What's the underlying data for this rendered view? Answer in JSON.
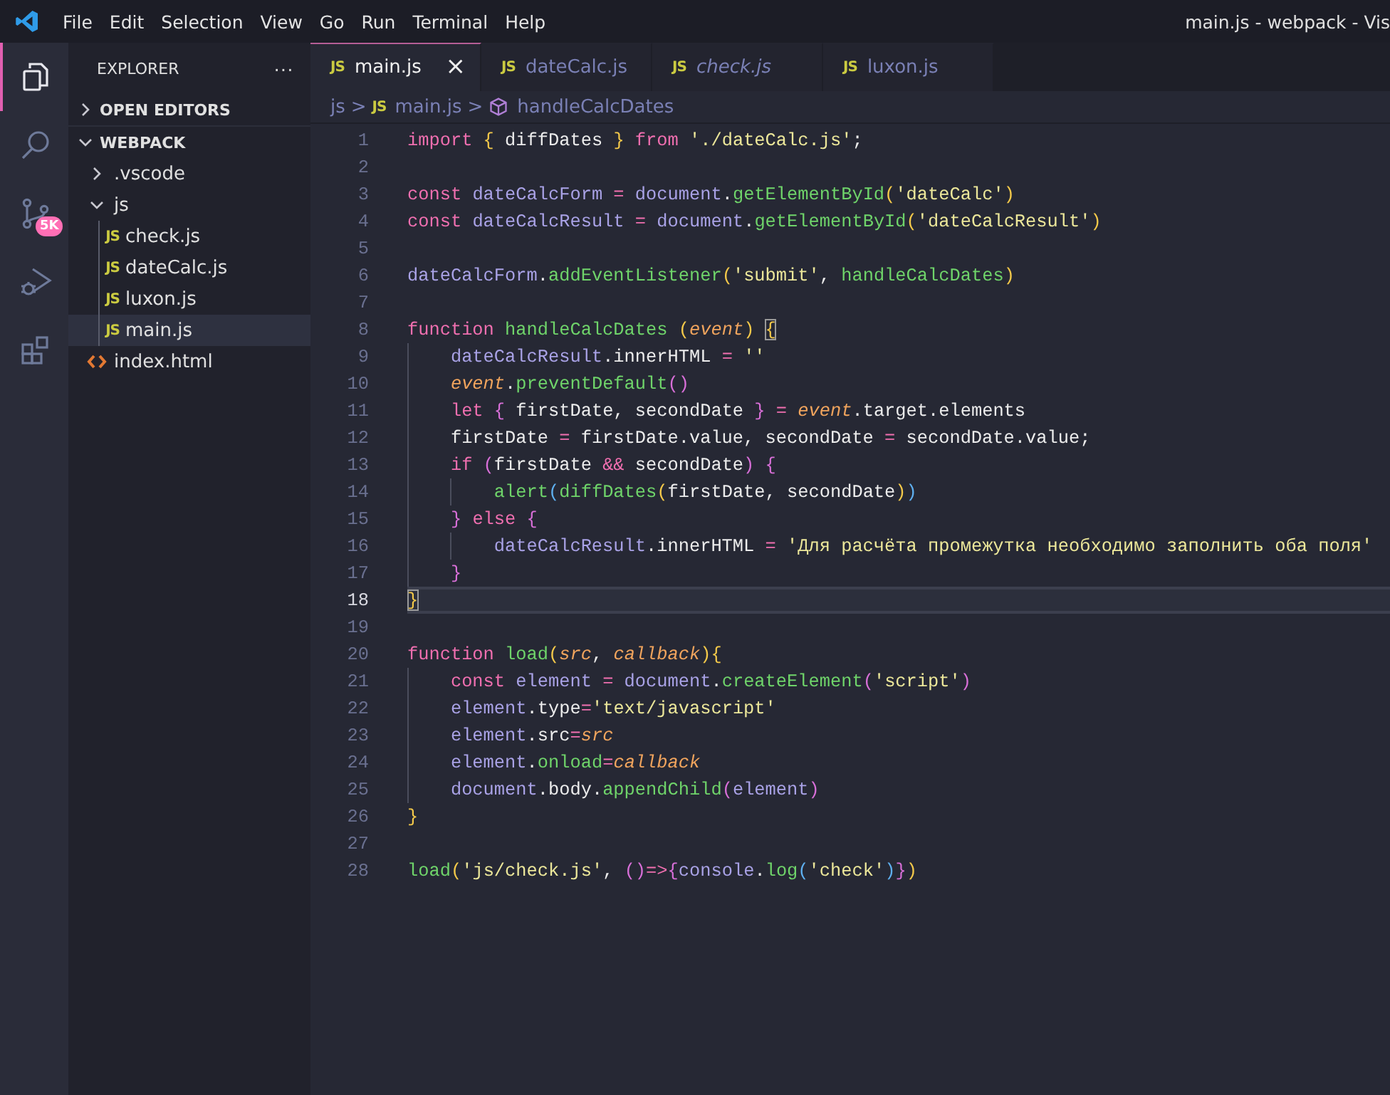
{
  "window": {
    "title": "main.js - webpack - Vis"
  },
  "menu": [
    "File",
    "Edit",
    "Selection",
    "View",
    "Go",
    "Run",
    "Terminal",
    "Help"
  ],
  "activity_bar": [
    {
      "kind": "explorer",
      "selected": true
    },
    {
      "kind": "search",
      "selected": false
    },
    {
      "kind": "source-control",
      "selected": false,
      "badge": "5K"
    },
    {
      "kind": "run-debug",
      "selected": false
    },
    {
      "kind": "extensions",
      "selected": false
    }
  ],
  "sidebar": {
    "title": "EXPLORER",
    "more": "···",
    "sections": [
      {
        "title": "OPEN EDITORS",
        "expanded": false
      },
      {
        "title": "WEBPACK",
        "expanded": true,
        "items": [
          {
            "name": ".vscode",
            "kind": "folder",
            "expanded": false,
            "selected": false
          },
          {
            "name": "js",
            "kind": "folder",
            "expanded": true,
            "selected": false,
            "children": [
              {
                "name": "check.js",
                "kind": "js",
                "icon": "JS",
                "selected": false
              },
              {
                "name": "dateCalc.js",
                "kind": "js",
                "icon": "JS",
                "selected": false
              },
              {
                "name": "luxon.js",
                "kind": "js",
                "icon": "JS",
                "selected": false
              },
              {
                "name": "main.js",
                "kind": "js",
                "icon": "JS",
                "selected": true
              }
            ]
          },
          {
            "name": "index.html",
            "kind": "html",
            "selected": false
          }
        ]
      }
    ]
  },
  "tabs": [
    {
      "label": "main.js",
      "icon": "JS",
      "selected": true,
      "preview": false,
      "close": "×"
    },
    {
      "label": "dateCalc.js",
      "icon": "JS",
      "selected": false,
      "preview": false
    },
    {
      "label": "check.js",
      "icon": "JS",
      "selected": false,
      "preview": true
    },
    {
      "label": "luxon.js",
      "icon": "JS",
      "selected": false,
      "preview": false
    }
  ],
  "breadcrumb": [
    {
      "kind": "folder",
      "label": "js"
    },
    {
      "kind": "js",
      "icon": "JS",
      "label": "main.js"
    },
    {
      "kind": "symbol",
      "label": "handleCalcDates"
    }
  ],
  "breadcrumb_separator": ">",
  "code": [
    {
      "number": "1",
      "current": false,
      "tokens": [
        {
          "text": "import ",
          "kind": "k"
        },
        {
          "text": "{",
          "kind": "b1"
        },
        {
          "text": " diffDates ",
          "kind": "w"
        },
        {
          "text": "}",
          "kind": "b1"
        },
        {
          "text": " from ",
          "kind": "k"
        },
        {
          "text": "'./dateCalc.js'",
          "kind": "s"
        },
        {
          "text": ";",
          "kind": "w"
        }
      ]
    },
    {
      "number": "2",
      "current": false
    },
    {
      "number": "3",
      "current": false,
      "tokens": [
        {
          "text": "const ",
          "kind": "k"
        },
        {
          "text": "dateCalcForm ",
          "kind": "v"
        },
        {
          "text": "= ",
          "kind": "o"
        },
        {
          "text": "document",
          "kind": "v"
        },
        {
          "text": ".",
          "kind": "w"
        },
        {
          "text": "getElementById",
          "kind": "f"
        },
        {
          "text": "(",
          "kind": "b1"
        },
        {
          "text": "'dateCalc'",
          "kind": "s"
        },
        {
          "text": ")",
          "kind": "b1"
        }
      ]
    },
    {
      "number": "4",
      "current": false,
      "tokens": [
        {
          "text": "const ",
          "kind": "k"
        },
        {
          "text": "dateCalcResult ",
          "kind": "v"
        },
        {
          "text": "= ",
          "kind": "o"
        },
        {
          "text": "document",
          "kind": "v"
        },
        {
          "text": ".",
          "kind": "w"
        },
        {
          "text": "getElementById",
          "kind": "f"
        },
        {
          "text": "(",
          "kind": "b1"
        },
        {
          "text": "'dateCalcResult'",
          "kind": "s"
        },
        {
          "text": ")",
          "kind": "b1"
        }
      ]
    },
    {
      "number": "5",
      "current": false
    },
    {
      "number": "6",
      "current": false,
      "tokens": [
        {
          "text": "dateCalcForm",
          "kind": "v"
        },
        {
          "text": ".",
          "kind": "w"
        },
        {
          "text": "addEventListener",
          "kind": "f"
        },
        {
          "text": "(",
          "kind": "b1"
        },
        {
          "text": "'submit'",
          "kind": "s"
        },
        {
          "text": ", ",
          "kind": "w"
        },
        {
          "text": "handleCalcDates",
          "kind": "f"
        },
        {
          "text": ")",
          "kind": "b1"
        }
      ]
    },
    {
      "number": "7",
      "current": false
    },
    {
      "number": "8",
      "current": false,
      "tokens": [
        {
          "text": "function ",
          "kind": "k"
        },
        {
          "text": "handleCalcDates ",
          "kind": "f"
        },
        {
          "text": "(",
          "kind": "b1"
        },
        {
          "text": "event",
          "kind": "p"
        },
        {
          "text": ") ",
          "kind": "b1"
        },
        {
          "text": "{",
          "kind": "bm"
        }
      ]
    },
    {
      "number": "9",
      "current": false,
      "tokens": [
        {
          "text": "    dateCalcResult",
          "kind": "v"
        },
        {
          "text": ".innerHTML ",
          "kind": "w"
        },
        {
          "text": "= ",
          "kind": "o"
        },
        {
          "text": "''",
          "kind": "s"
        }
      ]
    },
    {
      "number": "10",
      "current": false,
      "tokens": [
        {
          "text": "    event",
          "kind": "p"
        },
        {
          "text": ".",
          "kind": "w"
        },
        {
          "text": "preventDefault",
          "kind": "f"
        },
        {
          "text": "()",
          "kind": "b2"
        }
      ]
    },
    {
      "number": "11",
      "current": false,
      "tokens": [
        {
          "text": "    let ",
          "kind": "k"
        },
        {
          "text": "{",
          "kind": "b2"
        },
        {
          "text": " firstDate, secondDate ",
          "kind": "w"
        },
        {
          "text": "}",
          "kind": "b2"
        },
        {
          "text": " = ",
          "kind": "o"
        },
        {
          "text": "event",
          "kind": "p"
        },
        {
          "text": ".target.elements",
          "kind": "w"
        }
      ]
    },
    {
      "number": "12",
      "current": false,
      "tokens": [
        {
          "text": "    firstDate ",
          "kind": "w"
        },
        {
          "text": "= ",
          "kind": "o"
        },
        {
          "text": "firstDate.value, secondDate ",
          "kind": "w"
        },
        {
          "text": "= ",
          "kind": "o"
        },
        {
          "text": "secondDate.value;",
          "kind": "w"
        }
      ]
    },
    {
      "number": "13",
      "current": false,
      "tokens": [
        {
          "text": "    if ",
          "kind": "k"
        },
        {
          "text": "(",
          "kind": "b2"
        },
        {
          "text": "firstDate ",
          "kind": "w"
        },
        {
          "text": "&& ",
          "kind": "o"
        },
        {
          "text": "secondDate",
          "kind": "w"
        },
        {
          "text": ") {",
          "kind": "b2"
        }
      ]
    },
    {
      "number": "14",
      "current": false,
      "tokens": [
        {
          "text": "        alert",
          "kind": "f"
        },
        {
          "text": "(",
          "kind": "b3"
        },
        {
          "text": "diffDates",
          "kind": "f"
        },
        {
          "text": "(",
          "kind": "b1"
        },
        {
          "text": "firstDate, secondDate",
          "kind": "w"
        },
        {
          "text": ")",
          "kind": "b1"
        },
        {
          "text": ")",
          "kind": "b3"
        }
      ]
    },
    {
      "number": "15",
      "current": false,
      "tokens": [
        {
          "text": "    }",
          "kind": "b2"
        },
        {
          "text": " else ",
          "kind": "k"
        },
        {
          "text": "{",
          "kind": "b2"
        }
      ]
    },
    {
      "number": "16",
      "current": false,
      "tokens": [
        {
          "text": "        dateCalcResult",
          "kind": "v"
        },
        {
          "text": ".innerHTML ",
          "kind": "w"
        },
        {
          "text": "= ",
          "kind": "o"
        },
        {
          "text": "'Для расчёта промежутка необходимо заполнить оба поля'",
          "kind": "s"
        }
      ]
    },
    {
      "number": "17",
      "current": false,
      "tokens": [
        {
          "text": "    }",
          "kind": "b2"
        }
      ]
    },
    {
      "number": "18",
      "current": true,
      "tokens": [
        {
          "text": "}",
          "kind": "bm"
        }
      ]
    },
    {
      "number": "19",
      "current": false
    },
    {
      "number": "20",
      "current": false,
      "tokens": [
        {
          "text": "function ",
          "kind": "k"
        },
        {
          "text": "load",
          "kind": "f"
        },
        {
          "text": "(",
          "kind": "b1"
        },
        {
          "text": "src",
          "kind": "p"
        },
        {
          "text": ", ",
          "kind": "w"
        },
        {
          "text": "callback",
          "kind": "p"
        },
        {
          "text": "){",
          "kind": "b1"
        }
      ]
    },
    {
      "number": "21",
      "current": false,
      "tokens": [
        {
          "text": "    const ",
          "kind": "k"
        },
        {
          "text": "element ",
          "kind": "v"
        },
        {
          "text": "= ",
          "kind": "o"
        },
        {
          "text": "document",
          "kind": "v"
        },
        {
          "text": ".",
          "kind": "w"
        },
        {
          "text": "createElement",
          "kind": "f"
        },
        {
          "text": "(",
          "kind": "b2"
        },
        {
          "text": "'script'",
          "kind": "s"
        },
        {
          "text": ")",
          "kind": "b2"
        }
      ]
    },
    {
      "number": "22",
      "current": false,
      "tokens": [
        {
          "text": "    element",
          "kind": "v"
        },
        {
          "text": ".type",
          "kind": "w"
        },
        {
          "text": "=",
          "kind": "o"
        },
        {
          "text": "'text/javascript'",
          "kind": "s"
        }
      ]
    },
    {
      "number": "23",
      "current": false,
      "tokens": [
        {
          "text": "    element",
          "kind": "v"
        },
        {
          "text": ".src",
          "kind": "w"
        },
        {
          "text": "=",
          "kind": "o"
        },
        {
          "text": "src",
          "kind": "p"
        }
      ]
    },
    {
      "number": "24",
      "current": false,
      "tokens": [
        {
          "text": "    element",
          "kind": "v"
        },
        {
          "text": ".",
          "kind": "w"
        },
        {
          "text": "onload",
          "kind": "f"
        },
        {
          "text": "=",
          "kind": "o"
        },
        {
          "text": "callback",
          "kind": "p"
        }
      ]
    },
    {
      "number": "25",
      "current": false,
      "tokens": [
        {
          "text": "    document",
          "kind": "v"
        },
        {
          "text": ".body.",
          "kind": "w"
        },
        {
          "text": "appendChild",
          "kind": "f"
        },
        {
          "text": "(",
          "kind": "b2"
        },
        {
          "text": "element",
          "kind": "v"
        },
        {
          "text": ")",
          "kind": "b2"
        }
      ]
    },
    {
      "number": "26",
      "current": false,
      "tokens": [
        {
          "text": "}",
          "kind": "b1"
        }
      ]
    },
    {
      "number": "27",
      "current": false
    },
    {
      "number": "28",
      "current": false,
      "tokens": [
        {
          "text": "load",
          "kind": "f"
        },
        {
          "text": "(",
          "kind": "b1"
        },
        {
          "text": "'js/check.js'",
          "kind": "s"
        },
        {
          "text": ", ",
          "kind": "w"
        },
        {
          "text": "()",
          "kind": "b2"
        },
        {
          "text": "=>",
          "kind": "o"
        },
        {
          "text": "{",
          "kind": "b2"
        },
        {
          "text": "console",
          "kind": "v"
        },
        {
          "text": ".",
          "kind": "w"
        },
        {
          "text": "log",
          "kind": "f"
        },
        {
          "text": "(",
          "kind": "b3"
        },
        {
          "text": "'check'",
          "kind": "s"
        },
        {
          "text": ")",
          "kind": "b3"
        },
        {
          "text": "}",
          "kind": "b2"
        },
        {
          "text": ")",
          "kind": "b1"
        }
      ]
    }
  ]
}
